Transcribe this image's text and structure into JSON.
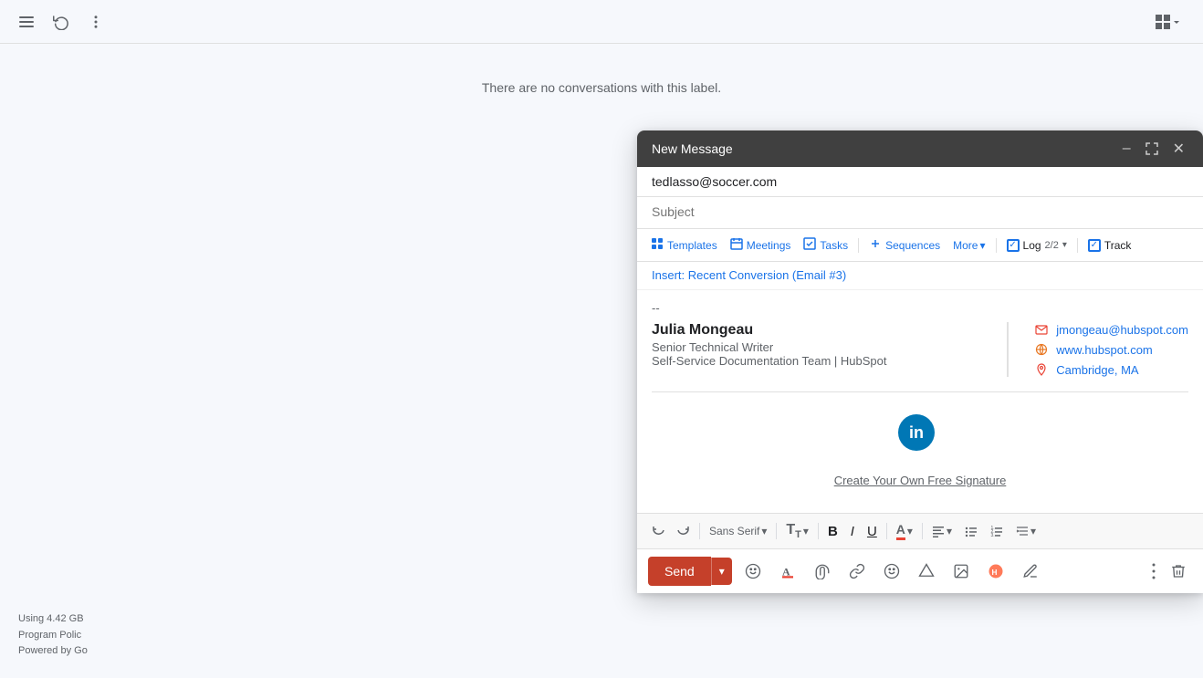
{
  "topbar": {
    "refresh_title": "Refresh",
    "more_title": "More"
  },
  "main": {
    "no_conversations": "There are no conversations with this label."
  },
  "footer": {
    "storage": "Using 4.42 GB",
    "program_policy": "Program Polic",
    "powered_by": "Powered by Go"
  },
  "compose": {
    "title": "New Message",
    "to_value": "tedlasso@soccer.com",
    "subject_placeholder": "Subject",
    "toolbar": {
      "templates": "Templates",
      "meetings": "Meetings",
      "tasks": "Tasks",
      "sequences": "Sequences",
      "more": "More",
      "log": "Log",
      "log_count": "2/2",
      "track": "Track"
    },
    "suggestion": "Insert: Recent Conversion (Email #3)",
    "signature": {
      "separator": "--",
      "name": "Julia Mongeau",
      "title": "Senior Technical Writer",
      "company": "Self-Service Documentation Team | HubSpot",
      "email": "jmongeau@hubspot.com",
      "website": "www.hubspot.com",
      "location": "Cambridge, MA"
    },
    "create_signature": "Create Your Own Free Signature",
    "send_btn": "Send",
    "format": {
      "font": "Sans Serif",
      "font_size": "TT"
    },
    "actions": {
      "undo": "↩",
      "redo": "↪",
      "bold": "B",
      "italic": "I",
      "underline": "U"
    }
  }
}
